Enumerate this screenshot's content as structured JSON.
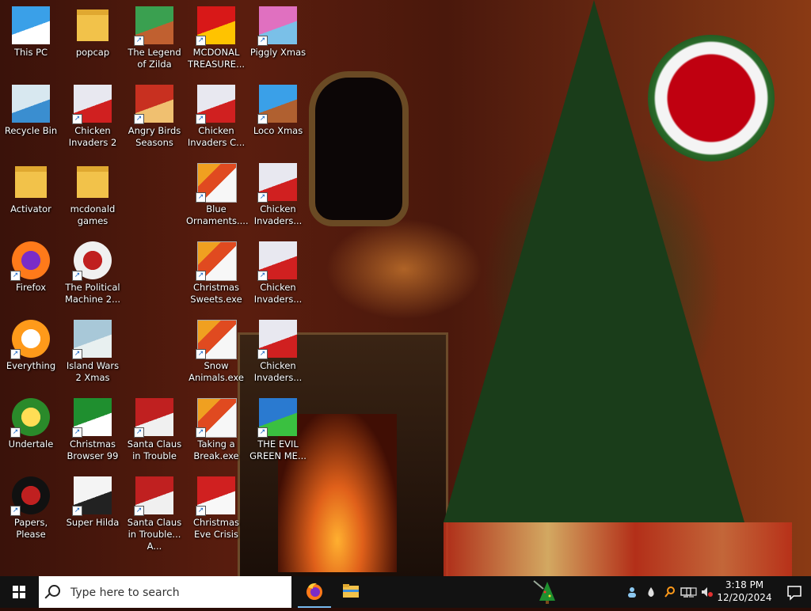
{
  "desktop": {
    "icons": [
      {
        "label": "This PC",
        "icon": "this-pc-icon"
      },
      {
        "label": "Recycle Bin",
        "icon": "recycle-bin-icon"
      },
      {
        "label": "Activator",
        "icon": "folder-icon"
      },
      {
        "label": "Firefox",
        "icon": "firefox-icon"
      },
      {
        "label": "The Political Machine 2...",
        "icon": "political-machine-icon"
      },
      {
        "label": "Everything",
        "icon": "everything-search-icon"
      },
      {
        "label": "Undertale",
        "icon": "undertale-icon"
      },
      {
        "label": "Papers, Please",
        "icon": "papers-please-icon"
      },
      {
        "label": "popcap",
        "icon": "folder-icon"
      },
      {
        "label": "Chicken Invaders 2",
        "icon": "chicken-invaders-icon"
      },
      {
        "label": "mcdonald games",
        "icon": "folder-icon"
      },
      {
        "label": "Island Wars 2 Xmas",
        "icon": "island-wars-icon"
      },
      {
        "label": "Christmas Browser 99",
        "icon": "christmas-tree-icon"
      },
      {
        "label": "Super Hilda",
        "icon": "super-hilda-icon"
      },
      {
        "label": "The Legend of Zilda",
        "icon": "zilda-icon"
      },
      {
        "label": "Angry Birds Seasons",
        "icon": "angry-birds-icon"
      },
      {
        "label": "Blue Ornaments....",
        "icon": "exe-file-icon"
      },
      {
        "label": "Christmas Sweets.exe",
        "icon": "exe-file-icon"
      },
      {
        "label": "Snow Animals.exe",
        "icon": "exe-file-icon"
      },
      {
        "label": "Santa Claus in Trouble",
        "icon": "santa-claus-icon"
      },
      {
        "label": "Santa Claus in Trouble... A...",
        "icon": "santa-claus-icon"
      },
      {
        "label": "MCDONAL TREASURE...",
        "icon": "mcdonalds-icon"
      },
      {
        "label": "Chicken Invaders C...",
        "icon": "chicken-invaders-icon"
      },
      {
        "label": "Taking a Break.exe",
        "icon": "exe-file-icon"
      },
      {
        "label": "Christmas Eve Crisis",
        "icon": "santa-face-icon"
      },
      {
        "label": "Piggly Xmas",
        "icon": "piggly-icon"
      },
      {
        "label": "Loco Xmas",
        "icon": "loco-xmas-icon"
      },
      {
        "label": "Chicken Invaders...",
        "icon": "chicken-invaders-icon"
      },
      {
        "label": "Chicken Invaders...",
        "icon": "chicken-invaders-icon"
      },
      {
        "label": "Chicken Invaders...",
        "icon": "chicken-invaders-icon"
      },
      {
        "label": "THE EVIL GREEN ME...",
        "icon": "messenger-icon"
      }
    ]
  },
  "taskbar": {
    "search_placeholder": "Type here to search",
    "pinned": [
      {
        "name": "firefox",
        "icon": "firefox-icon",
        "active": true
      },
      {
        "name": "file-explorer",
        "icon": "file-explorer-icon",
        "active": false
      }
    ],
    "quick_launch": [
      {
        "icon": "christmas-tree-icon"
      }
    ],
    "tray_icons": [
      "people-icon",
      "drop-icon",
      "search-magnifier-icon",
      "update-icon",
      "network-icon",
      "volume-muted-icon"
    ],
    "clock": {
      "time": "3:18 PM",
      "date": "12/20/2024"
    }
  }
}
